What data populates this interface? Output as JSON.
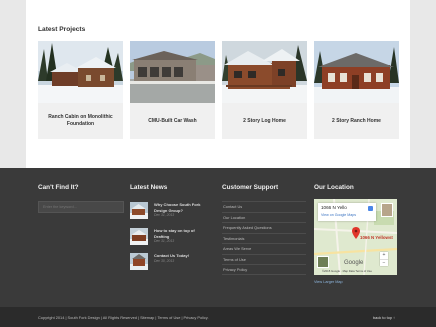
{
  "projects": {
    "title": "Latest Projects",
    "items": [
      {
        "caption": "Ranch Cabin on Monolithic Foundation"
      },
      {
        "caption": "CMU-Built Car Wash"
      },
      {
        "caption": "2 Story Log Home"
      },
      {
        "caption": "2 Story Ranch Home"
      }
    ]
  },
  "footer": {
    "cant_find": {
      "title": "Can't Find It?",
      "search_placeholder": "Enter the keyword..."
    },
    "news": {
      "title": "Latest News",
      "items": [
        {
          "title": "Why Choose South Fork Design Group?",
          "date": "Dec 31, 2013"
        },
        {
          "title": "How to stay on top of Drafting",
          "date": "Dec 31, 2013"
        },
        {
          "title": "Contact Us Today!",
          "date": "Dec 30, 2013"
        }
      ]
    },
    "support": {
      "title": "Customer Support",
      "items": [
        "Contact Us",
        "Our Location",
        "Frequently Asked Questions",
        "Testimonials",
        "Areas We Serve",
        "Terms of Use",
        "Privacy Policy"
      ]
    },
    "location": {
      "title": "Our Location",
      "map_place": "1066 N Yello",
      "map_link": "View on Google Maps",
      "marker_label": "1066 N Yellowst",
      "map_brand": "Google",
      "map_footer": "©2015 Google · Map Data   Terms of Use",
      "larger_map": "View Larger Map"
    }
  },
  "bottom": {
    "copyright": "Copyright 2014 | South Fork Design | All Rights Reserved | Sitemap | Terms of Use | Privacy Policy.",
    "back_to_top": "back to top ↑"
  }
}
